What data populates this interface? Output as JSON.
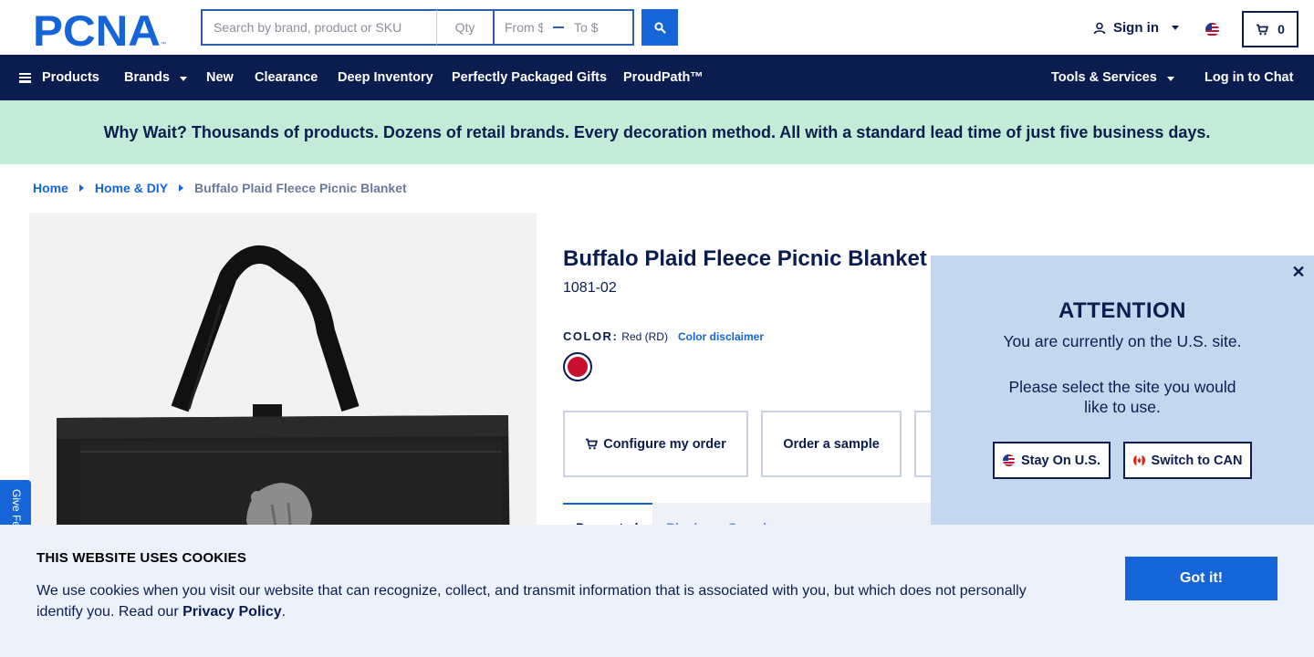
{
  "header": {
    "logo_text": "PCNA",
    "search_placeholder": "Search by brand, product or SKU",
    "qty_placeholder": "Qty",
    "price_from_placeholder": "From $",
    "price_to_placeholder": "To $",
    "sign_in_label": "Sign in",
    "cart_count": "0",
    "icons": [
      "search-icon",
      "user-icon",
      "us-flag-icon",
      "cart-icon"
    ]
  },
  "nav": {
    "products": "Products",
    "brands": "Brands",
    "new": "New",
    "clearance": "Clearance",
    "deep_inventory": "Deep Inventory",
    "perfectly_packaged_gifts": "Perfectly Packaged Gifts",
    "proudpath": "ProudPath™",
    "tools_services": "Tools & Services",
    "log_in_chat": "Log in to Chat"
  },
  "promo": {
    "text": "Why Wait? Thousands of products. Dozens of retail brands. Every decoration method. All with a standard lead time of just five business days."
  },
  "breadcrumb": {
    "items": [
      "Home",
      "Home & DIY"
    ],
    "current": "Buffalo Plaid Fleece Picnic Blanket"
  },
  "product": {
    "title": "Buffalo Plaid Fleece Picnic Blanket",
    "sku": "1081-02",
    "color_label": "COLOR:",
    "color_value": "Red (RD)",
    "color_disclaimer": "Color disclaimer",
    "swatch_color": "#c8102e",
    "actions": {
      "configure": "Configure my order",
      "sample": "Order a sample"
    },
    "tabs": {
      "decorated": "Decorated",
      "blank": "Blank",
      "samples": "Samples"
    }
  },
  "attention": {
    "title": "ATTENTION",
    "message_1": "You are currently on the U.S. site.",
    "message_2": "Please select the site you would like to use.",
    "stay_label": "Stay On U.S.",
    "switch_label": "Switch to CAN",
    "close_symbol": "✕"
  },
  "feedback": {
    "label": "Give Feedback"
  },
  "cookie": {
    "title": "THIS WEBSITE USES COOKIES",
    "text": "We use cookies when you visit our website that can recognize, collect, and transmit information that is associated with you, but which does not personally identify you. Read our",
    "privacy_link": "Privacy Policy",
    "period": ".",
    "button": "Got it!"
  },
  "colors": {
    "navy": "#0b1d4f",
    "brand_blue": "#1565d8",
    "promo_green": "#c2ecd7",
    "attention_bg": "#c5d6ef",
    "cookie_bg": "#ebf2fc"
  }
}
